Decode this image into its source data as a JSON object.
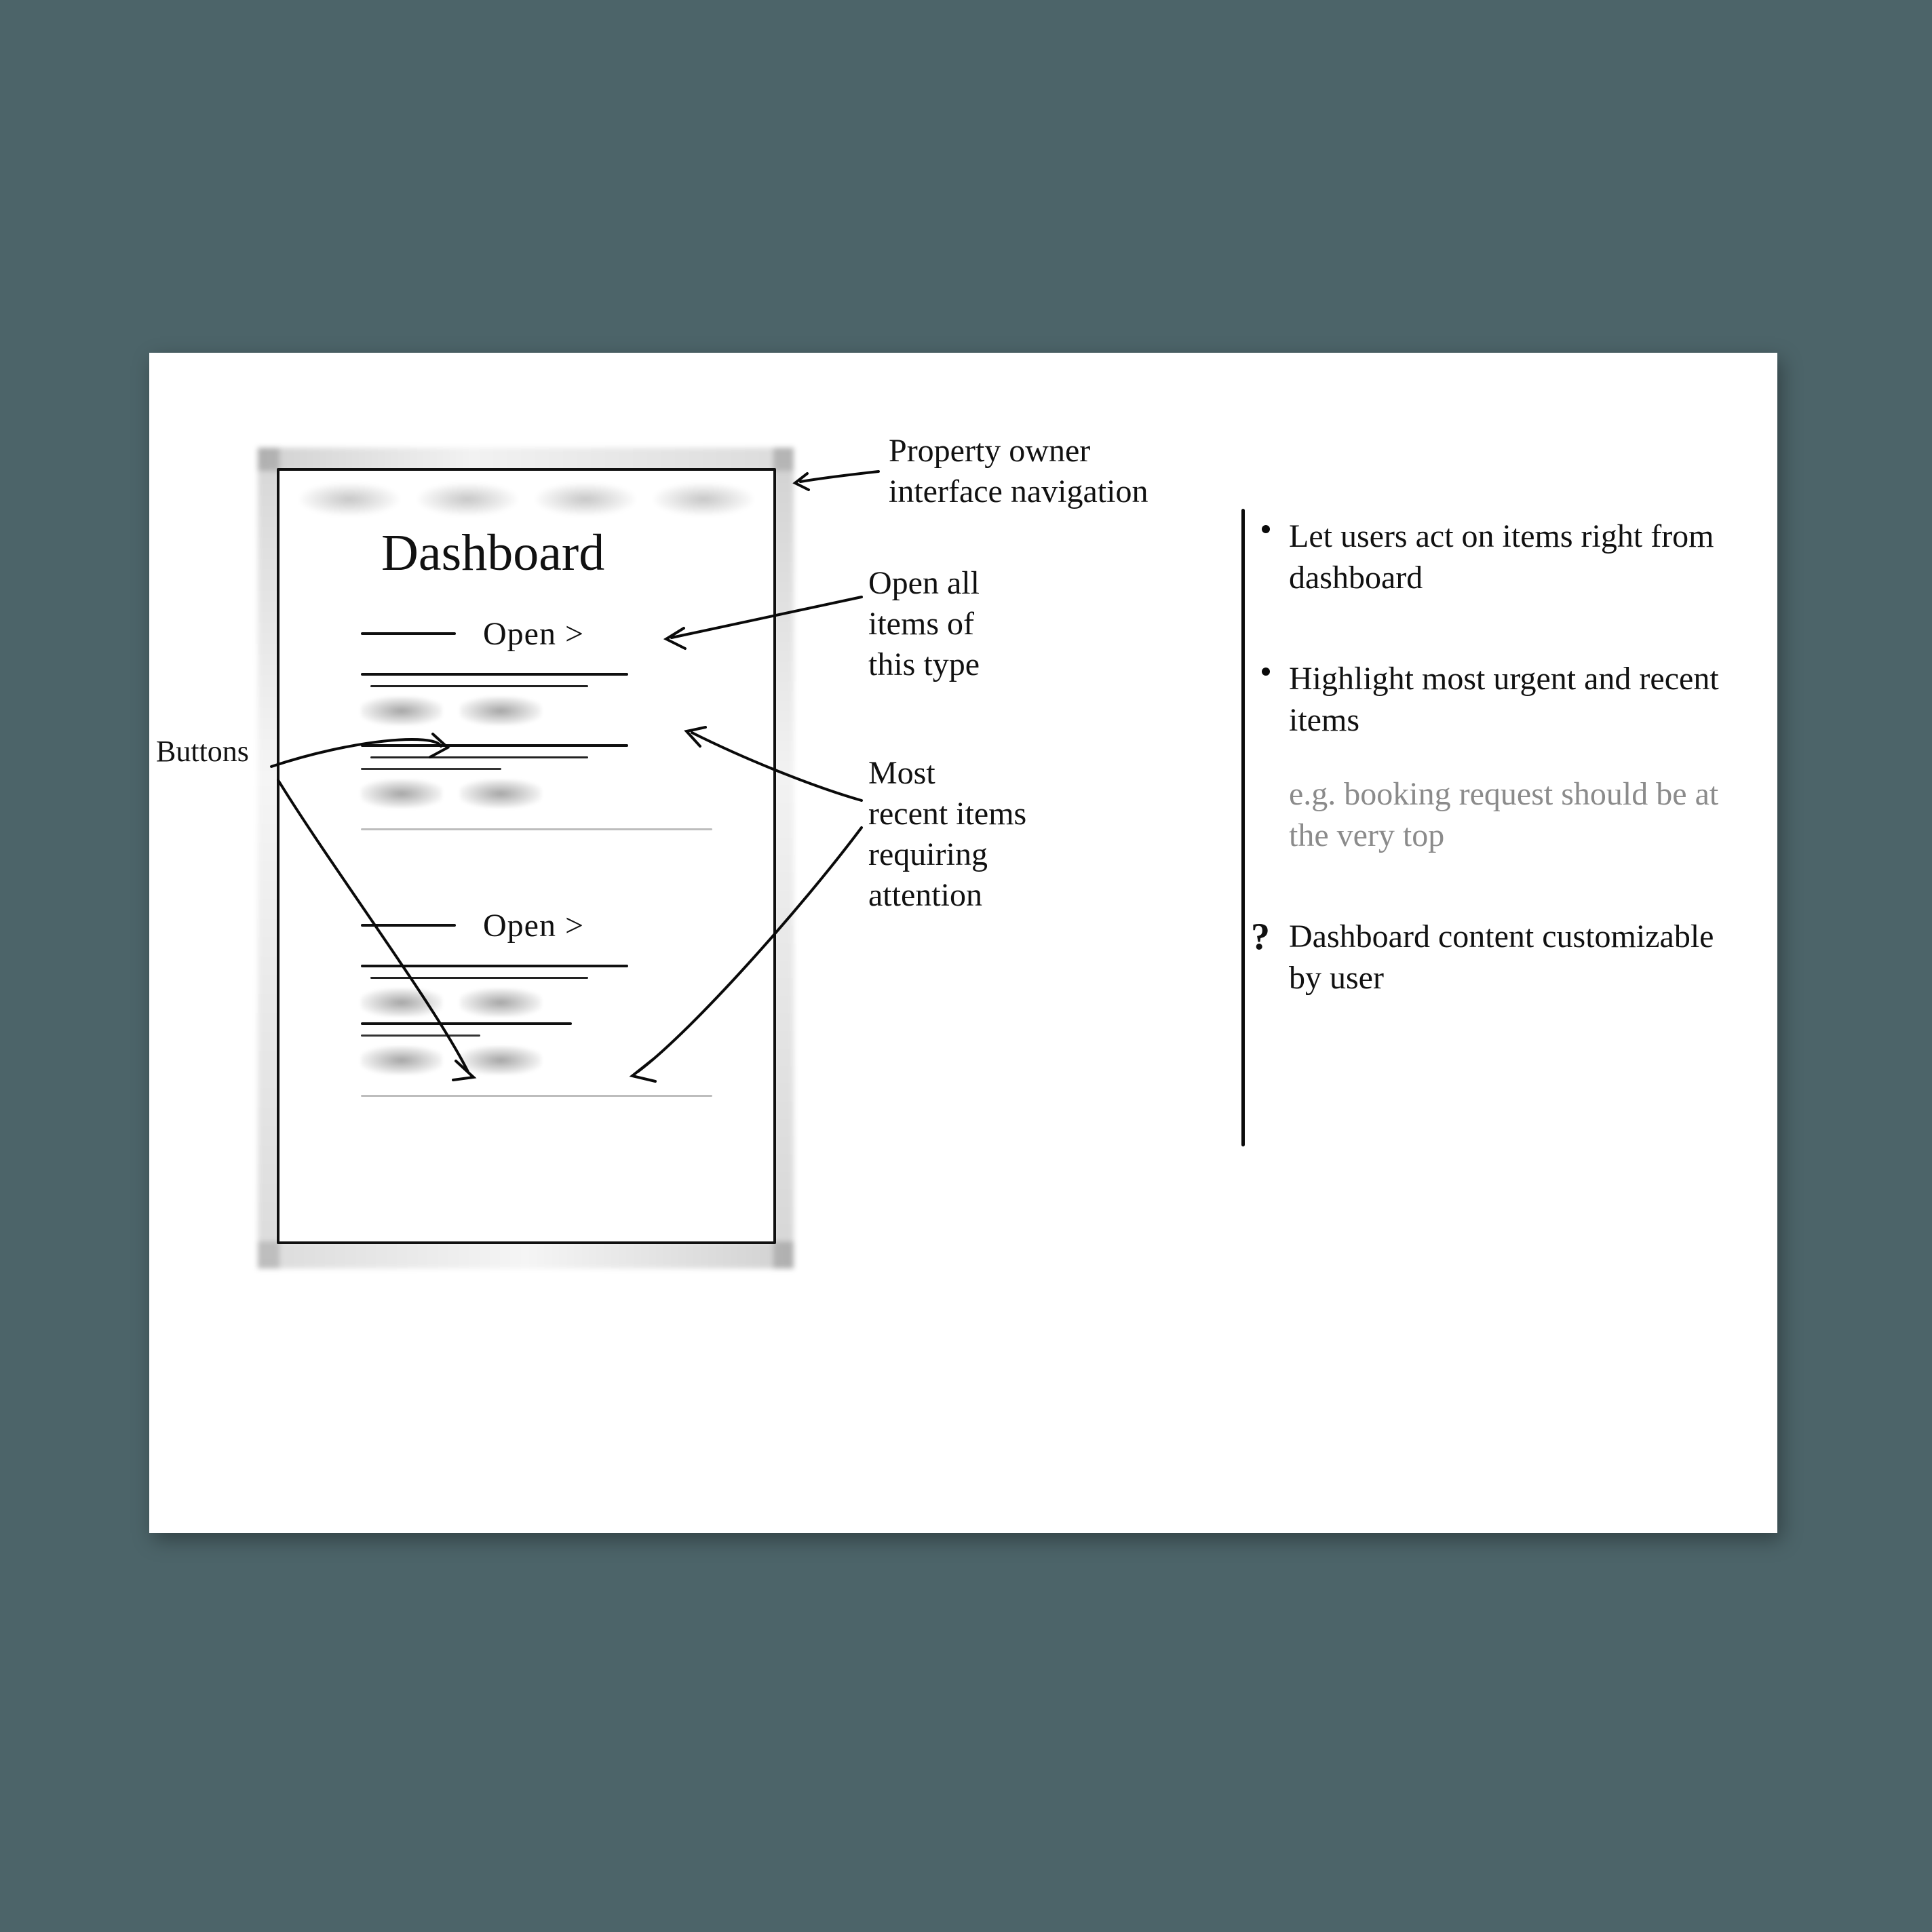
{
  "wireframe": {
    "title": "Dashboard",
    "open_label": "Open >"
  },
  "annotations": {
    "nav": "Property owner\ninterface navigation",
    "open_all": "Open all\nitems of\nthis type",
    "recent": "Most\nrecent items\nrequiring\nattention",
    "buttons": "Buttons"
  },
  "notes": {
    "n1": "Let users act on\nitems right from\ndashboard",
    "n2": "Highlight most\nurgent and recent\nitems",
    "n2_example": "e.g. booking request\nshould be at the\nvery top",
    "n3_marker": "?",
    "n3": "Dashboard content\ncustomizable by\nuser"
  }
}
